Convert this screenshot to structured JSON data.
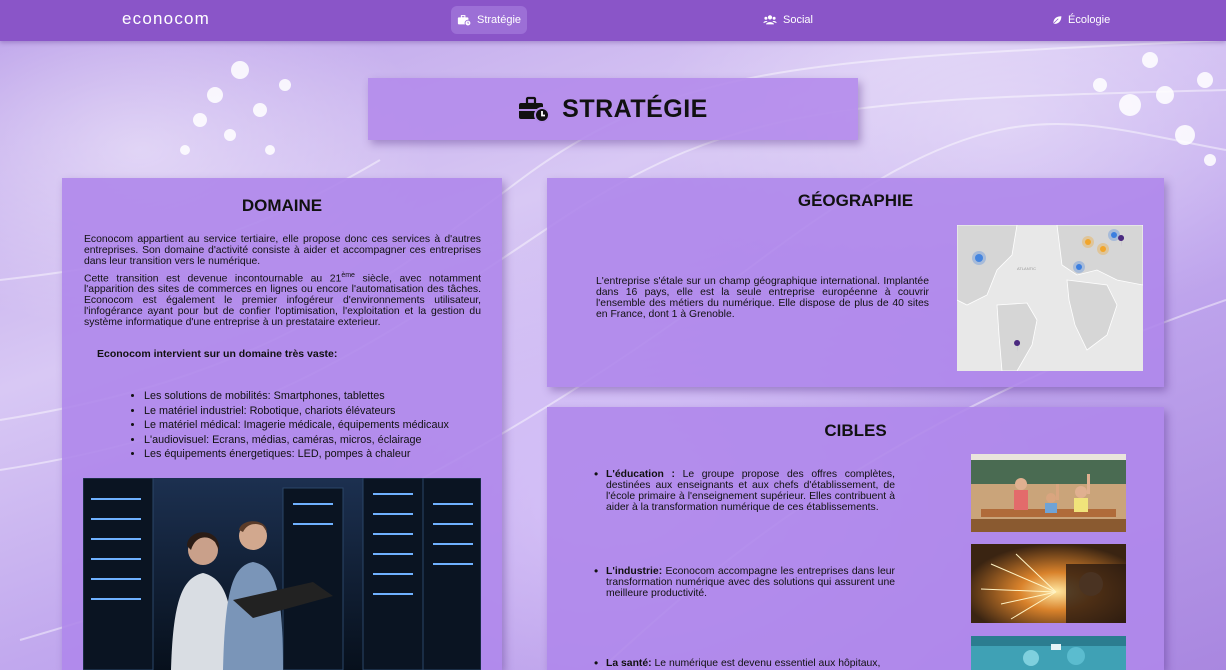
{
  "nav": {
    "brand": "econocom",
    "items": [
      {
        "label": "Stratégie",
        "icon": "briefcase-clock-icon",
        "active": true
      },
      {
        "label": "Social",
        "icon": "users-icon",
        "active": false
      },
      {
        "label": "Écologie",
        "icon": "leaf-icon",
        "active": false
      }
    ]
  },
  "page": {
    "title": "STRATÉGIE",
    "title_icon": "briefcase-clock-icon"
  },
  "domaine": {
    "heading": "DOMAINE",
    "p1": "Econocom appartient au service tertiaire, elle propose donc ces services à d'autres entreprises. Son domaine d'activité consiste à aider et accompagner ces entreprises dans leur transition vers le numérique.",
    "p2_before": "Cette transition est devenue incontournable au 21",
    "p2_sup": "ème",
    "p2_after": " siècle, avec notamment l'apparition des sites de commerces en lignes ou encore l'automatisation des tâches. Econocom est également le premier infogéreur d'environnements utilisateur, l'infogérance ayant pour but de confier l'optimisation, l'exploitation et la gestion du système informatique d'une entreprise à un prestataire exterieur.",
    "lead": "Econocom intervient sur un domaine très vaste:",
    "items": [
      "Les solutions de mobilités: Smartphones, tablettes",
      "Le matériel industriel: Robotique, chariots élévateurs",
      "Le matériel médical: Imagerie médicale, équipements médicaux",
      "L'audiovisuel: Ecrans, médias, caméras, micros, éclairage",
      "Les équipements énergetiques: LED, pompes à chaleur"
    ],
    "photo": "datacenter-photo"
  },
  "geographie": {
    "heading": "GÉOGRAPHIE",
    "text": "L'entreprise s'étale sur un champ géographique international. Implantée dans 16 pays, elle est la seule entreprise européenne à couvrir l'ensemble des métiers du numérique. Elle dispose de plus de 40 sites en France, dont 1 à Grenoble.",
    "map": "world-map-image"
  },
  "cibles": {
    "heading": "CIBLES",
    "items": [
      {
        "title": "L'éducation :",
        "text": " Le groupe propose des offres complètes, destinées aux enseignants et aux chefs d'établissement, de l'école primaire à l'enseignement supérieur. Elles contribuent à aider à la transformation numérique de ces établissements.",
        "image": "classroom-photo"
      },
      {
        "title": "L'industrie:",
        "text": " Econocom accompagne les entreprises dans leur transformation numérique avec des solutions qui assurent une meilleure productivité.",
        "image": "industry-sparks-photo"
      },
      {
        "title": "La santé:",
        "text": " Le numérique est devenu essentiel aux hôpitaux,",
        "image": "surgery-photo"
      }
    ]
  },
  "colors": {
    "nav_bg": "#8a55c8",
    "nav_active": "#9c6fd6",
    "card_bg": "#af87eb"
  }
}
